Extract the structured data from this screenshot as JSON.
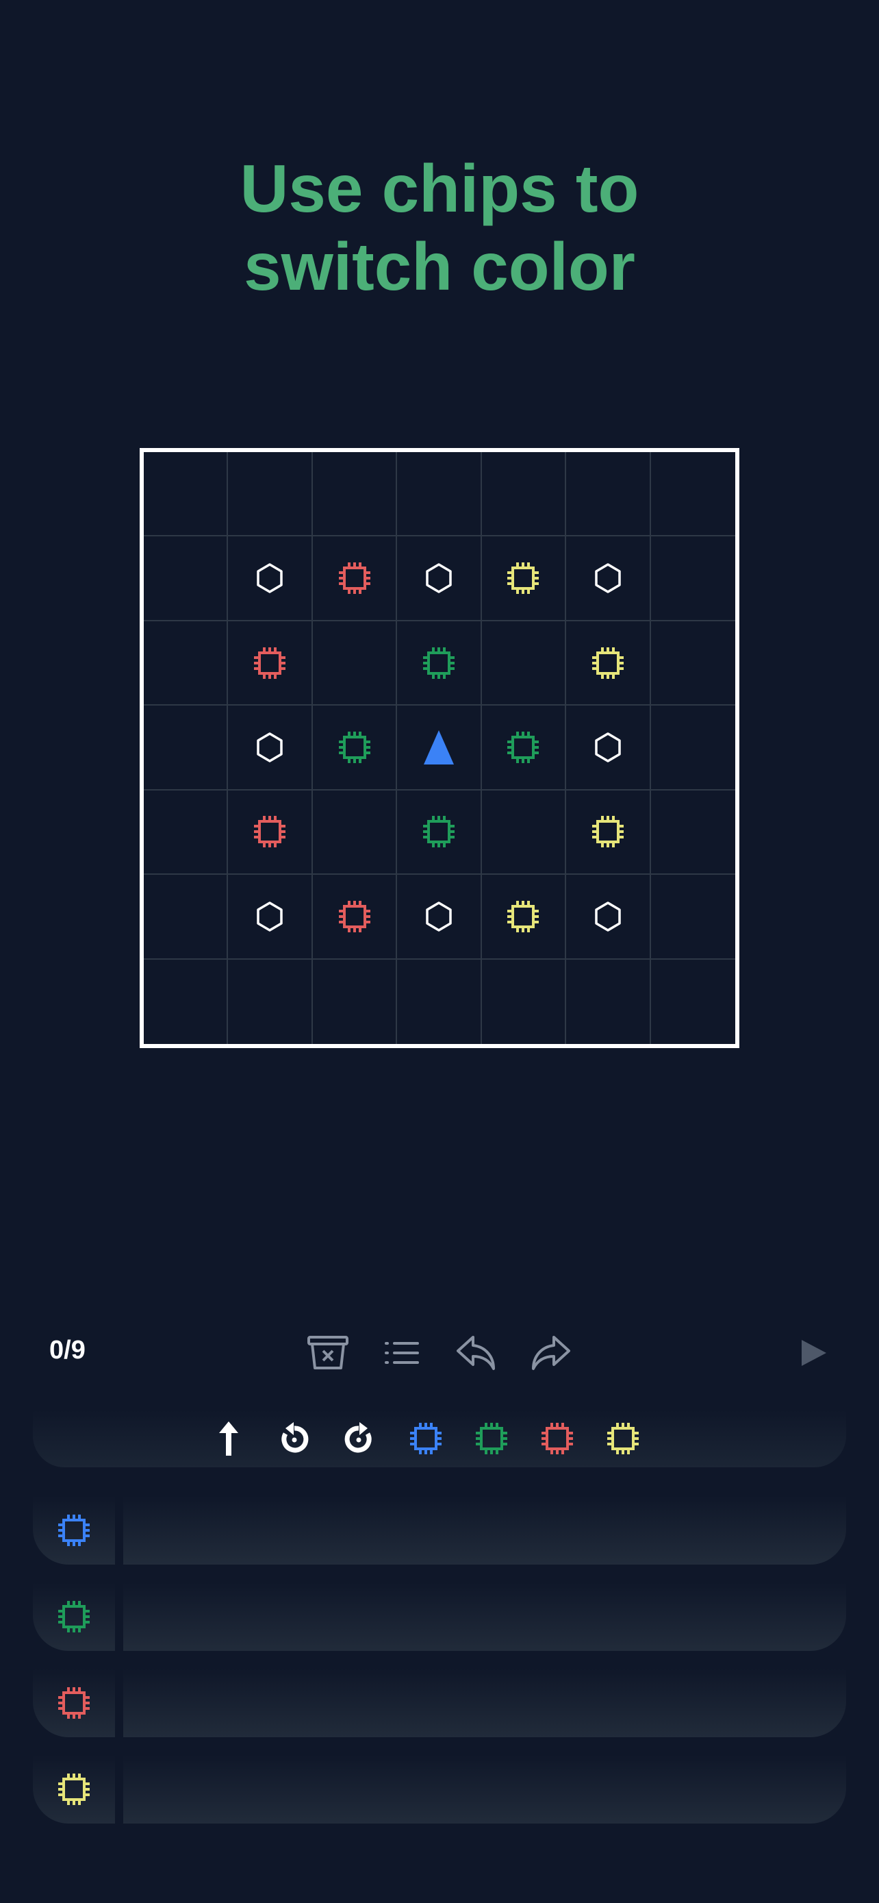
{
  "title": {
    "line1": "Use chips to",
    "line2": "switch color"
  },
  "colors": {
    "background": "#0f1729",
    "title": "#4caf78",
    "blue": "#3b82f6",
    "green": "#1f9d5a",
    "red": "#e35d5d",
    "yellow": "#e6e57a",
    "white": "#ffffff"
  },
  "board": {
    "size": 7,
    "cells": [
      [
        "",
        "",
        "",
        "",
        "",
        "",
        ""
      ],
      [
        "",
        "hexagon-white",
        "chip-red",
        "hexagon-white",
        "chip-yellow",
        "hexagon-white",
        ""
      ],
      [
        "",
        "chip-red",
        "",
        "chip-green",
        "",
        "chip-yellow",
        ""
      ],
      [
        "",
        "hexagon-white",
        "chip-green",
        "player-blue",
        "chip-green",
        "hexagon-white",
        ""
      ],
      [
        "",
        "chip-red",
        "",
        "chip-green",
        "",
        "chip-yellow",
        ""
      ],
      [
        "",
        "hexagon-white",
        "chip-red",
        "hexagon-white",
        "chip-yellow",
        "hexagon-white",
        ""
      ],
      [
        "",
        "",
        "",
        "",
        "",
        "",
        ""
      ]
    ]
  },
  "controls": {
    "counter": "0/9",
    "buttons": [
      "clear-icon",
      "list-icon",
      "undo-icon",
      "redo-icon",
      "play-icon"
    ]
  },
  "palette": [
    "forward-arrow-icon",
    "rotate-left-icon",
    "rotate-right-icon",
    "chip-blue",
    "chip-green",
    "chip-red",
    "chip-yellow"
  ],
  "program_rows": [
    {
      "icon": "chip-blue"
    },
    {
      "icon": "chip-green"
    },
    {
      "icon": "chip-red"
    },
    {
      "icon": "chip-yellow"
    }
  ]
}
